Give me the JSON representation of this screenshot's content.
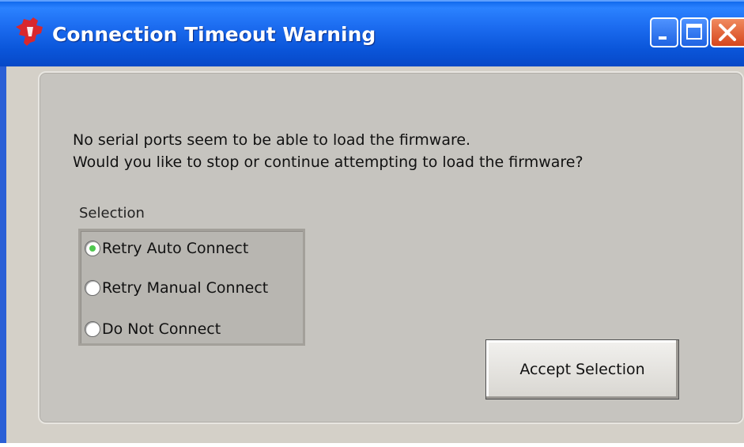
{
  "window": {
    "title": "Connection Timeout Warning",
    "icon": "ti-logo-icon",
    "controls": {
      "minimize": "minimize-icon",
      "maximize": "maximize-icon",
      "close": "close-icon"
    }
  },
  "message": {
    "line1": "No serial ports seem to be able to load the firmware.",
    "line2": "Would you like to stop or continue attempting to load the firmware?"
  },
  "selection": {
    "label": "Selection",
    "options": [
      {
        "label": "Retry Auto Connect",
        "checked": true
      },
      {
        "label": "Retry Manual Connect",
        "checked": false
      },
      {
        "label": "Do Not Connect",
        "checked": false
      }
    ]
  },
  "accept_button": {
    "label": "Accept Selection"
  },
  "colors": {
    "titlebar": "#0b5ce0",
    "client": "#d4d0c8",
    "panel": "#c6c4bf",
    "radio_checked": "#4fc84f",
    "close_button": "#d6461c"
  }
}
